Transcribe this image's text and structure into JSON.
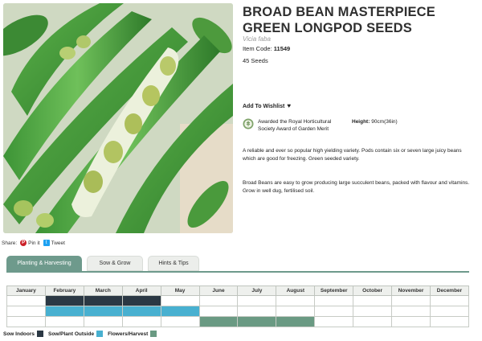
{
  "product": {
    "title_line1": "BROAD BEAN MASTERPIECE",
    "title_line2": "GREEN LONGPOD SEEDS",
    "latin_name": "Vicia faba",
    "item_code_label": "Item Code:",
    "item_code": "11549",
    "seeds": "45 Seeds",
    "wishlist_label": "Add To Wishlist",
    "award_text": "Awarded the Royal Horticultural Society Award of Garden Merit",
    "height_label": "Height:",
    "height_value": "90cm(36in)",
    "description_1": "A reliable and ever so popular high yielding variety. Pods contain six or seven large juicy beans which are good for freezing. Green seeded variety.",
    "description_2": "Broad Beans are easy to grow producing large succulent beans, packed with flavour and vitamins. Grow in well dug, fertilised soil."
  },
  "share": {
    "label": "Share:",
    "pinterest": "Pin it",
    "twitter": "Tweet"
  },
  "tabs": [
    {
      "label": "Planting & Harvesting",
      "active": true
    },
    {
      "label": "Sow & Grow",
      "active": false
    },
    {
      "label": "Hints & Tips",
      "active": false
    }
  ],
  "calendar": {
    "months": [
      "January",
      "February",
      "March",
      "April",
      "May",
      "June",
      "July",
      "August",
      "September",
      "October",
      "November",
      "December"
    ],
    "rows": [
      {
        "activity": "Sow Indoors",
        "months": [
          "February",
          "March",
          "April"
        ]
      },
      {
        "activity": "Sow/Plant Outside",
        "months": [
          "February",
          "March",
          "April",
          "May"
        ]
      },
      {
        "activity": "Flowers/Harvest",
        "months": [
          "June",
          "July",
          "August"
        ]
      }
    ]
  },
  "legend": [
    {
      "label": "Sow Indoors",
      "color": "#2b3844"
    },
    {
      "label": "Sow/Plant Outside",
      "color": "#48b0d0"
    },
    {
      "label": "Flowers/Harvest",
      "color": "#6a9a83"
    }
  ],
  "colors": {
    "accent": "#6e9a8c",
    "sow_indoors": "#2b3844",
    "sow_outside": "#48b0d0",
    "harvest": "#6a9a83"
  },
  "icons": [
    "rhs-award-icon",
    "heart-icon",
    "pinterest-icon",
    "twitter-icon"
  ]
}
